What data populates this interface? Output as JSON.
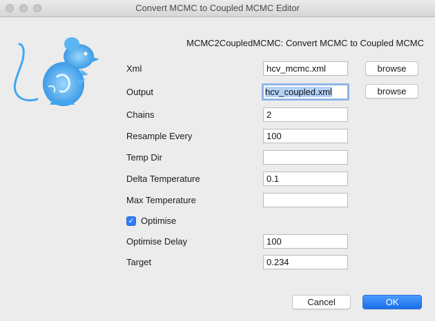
{
  "window": {
    "title": "Convert MCMC to Coupled MCMC Editor"
  },
  "heading": "MCMC2CoupledMCMC: Convert MCMC to Coupled MCMC",
  "fields": {
    "xml": {
      "label": "Xml",
      "value": "hcv_mcmc.xml"
    },
    "output": {
      "label": "Output",
      "value": "hcv_coupled.xml"
    },
    "chains": {
      "label": "Chains",
      "value": "2"
    },
    "resample_every": {
      "label": "Resample Every",
      "value": "100"
    },
    "temp_dir": {
      "label": "Temp Dir",
      "value": ""
    },
    "delta_temperature": {
      "label": "Delta Temperature",
      "value": "0.1"
    },
    "max_temperature": {
      "label": "Max Temperature",
      "value": ""
    },
    "optimise": {
      "label": "Optimise",
      "checked": true
    },
    "optimise_delay": {
      "label": "Optimise Delay",
      "value": "100"
    },
    "target": {
      "label": "Target",
      "value": "0.234"
    }
  },
  "buttons": {
    "browse": "browse",
    "cancel": "Cancel",
    "ok": "OK"
  },
  "icons": {
    "check": "✓",
    "mascot": "beast-mouse-icon"
  },
  "colors": {
    "accent": "#2f7cf6",
    "mascot": "#3fa6ef"
  }
}
